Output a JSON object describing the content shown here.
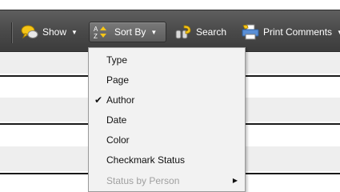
{
  "toolbar": {
    "show_label": "Show",
    "sortby_label": "Sort By",
    "search_label": "Search",
    "print_label": "Print Comments"
  },
  "sort_menu": {
    "items": [
      {
        "label": "Type",
        "checked": false,
        "enabled": true
      },
      {
        "label": "Page",
        "checked": false,
        "enabled": true
      },
      {
        "label": "Author",
        "checked": true,
        "enabled": true
      },
      {
        "label": "Date",
        "checked": false,
        "enabled": true
      },
      {
        "label": "Color",
        "checked": false,
        "enabled": true
      },
      {
        "label": "Checkmark Status",
        "checked": false,
        "enabled": true
      },
      {
        "label": "Status by Person",
        "checked": false,
        "enabled": false,
        "has_submenu": true
      }
    ],
    "check_glyph": "✔",
    "submenu_glyph": "▶"
  },
  "colors": {
    "toolbar": "#4a4a4a",
    "menu_bg": "#f2f2f2",
    "disabled_text": "#a0a0a0",
    "icon_yellow": "#f5c518"
  },
  "icons": {
    "show": "speech-bubbles-icon",
    "sort": "az-sort-icon",
    "search": "binoculars-icon",
    "print": "printer-icon"
  }
}
